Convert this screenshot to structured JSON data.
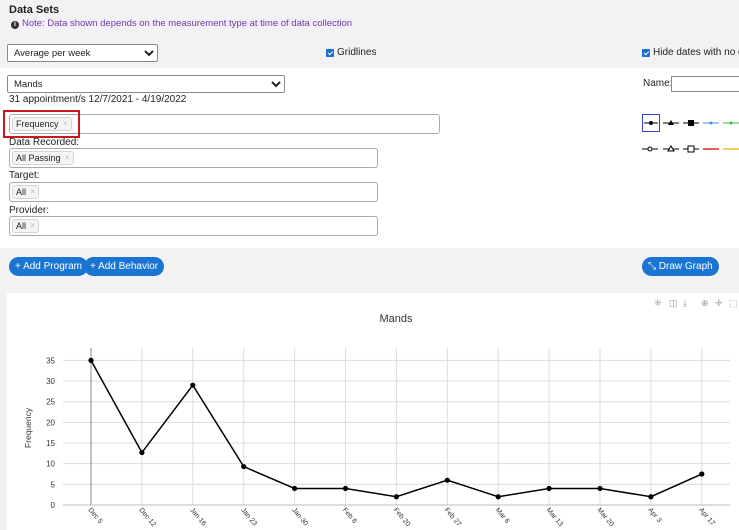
{
  "header": {
    "title": "Data Sets",
    "note": "Note: Data shown depends on the measurement type at time of data collection"
  },
  "controls": {
    "aggregate_value": "Average per week",
    "gridlines_label": "Gridlines",
    "hide_dates_label": "Hide dates with no da",
    "program_value": "Mands",
    "appointments_text": "31 appointment/s 12/7/2021 - 4/19/2022",
    "measure_chip": "Frequency",
    "data_recorded_label": "Data Recorded:",
    "data_recorded_chip": "All Passing",
    "target_label": "Target:",
    "target_chip": "All",
    "provider_label": "Provider:",
    "provider_chip": "All",
    "name_label": "Name:"
  },
  "line_styles": {
    "colors": [
      "#000000",
      "#000000",
      "#000000",
      "#4a90e2",
      "#3cbf3c",
      "#000000",
      "#000000",
      "#000000",
      "#e02424",
      "#f0c020"
    ]
  },
  "buttons": {
    "add_program": "+ Add Program",
    "add_behavior": "+ Add Behavior",
    "draw_graph": "Draw Graph"
  },
  "toolbar": {
    "icons": [
      "pan-icon",
      "select-icon",
      "download-icon",
      "zoom-icon",
      "move-icon",
      "box-select-icon"
    ]
  },
  "chart_data": {
    "type": "line",
    "title": "Mands",
    "ylabel": "Frequency",
    "xlabel": "",
    "categories": [
      "Dec 5",
      "Dec 12",
      "Jan 16",
      "Jan 23",
      "Jan 30",
      "Feb 6",
      "Feb 20",
      "Feb 27",
      "Mar 6",
      "Mar 13",
      "Mar 20",
      "Apr 3",
      "Apr 17"
    ],
    "values": [
      35,
      12.7,
      29,
      9.3,
      4,
      4,
      2,
      6,
      2,
      4,
      4,
      2,
      7.5
    ],
    "ylim": [
      0,
      38
    ],
    "yticks": [
      0,
      5,
      10,
      15,
      20,
      25,
      30,
      35
    ],
    "grid": true,
    "line_color": "#000000"
  }
}
